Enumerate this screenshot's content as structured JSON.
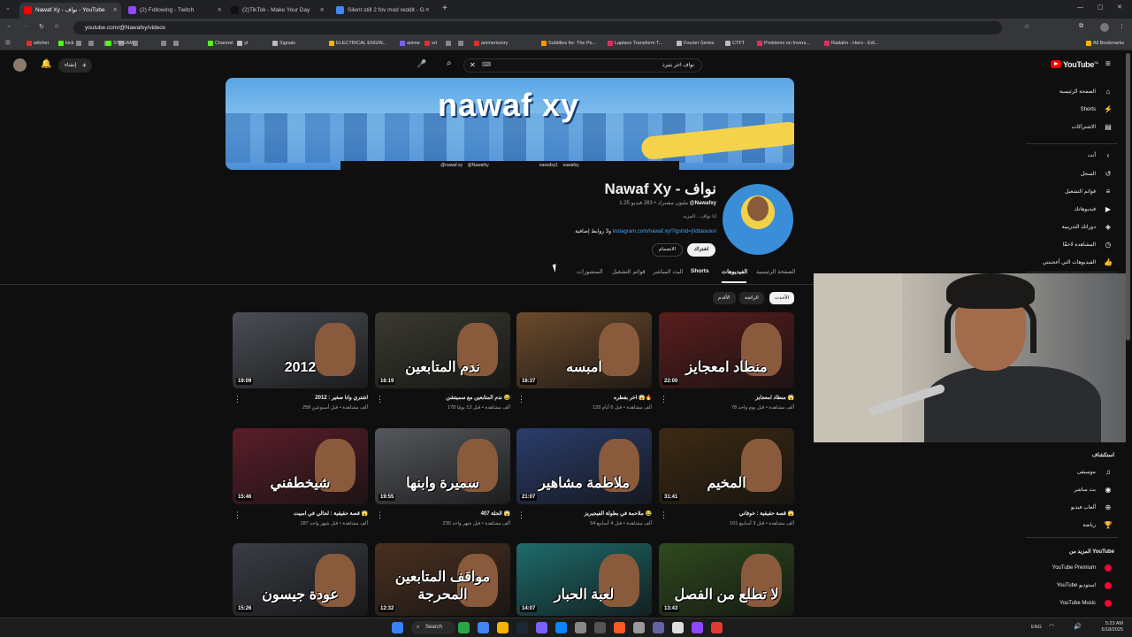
{
  "browser": {
    "tabs": [
      {
        "title": "Nawaf Xy - نواف - YouTube",
        "color": "#ff0000",
        "active": true
      },
      {
        "title": "(2) Following - Twitch",
        "color": "#9146ff",
        "active": false
      },
      {
        "title": "(2)TikTok - Make Your Day",
        "color": "#111111",
        "active": false
      },
      {
        "title": "Silent still 2 fov mod reddit - G",
        "color": "#4285f4",
        "active": false
      }
    ],
    "new_tab": "+",
    "url": "youtube.com/@Nawafxy/videos",
    "bookmarks": [
      {
        "label": "witcher",
        "color": "#e03030"
      },
      {
        "label": "kick",
        "color": "#53fc18"
      },
      {
        "label": "STREAM",
        "color": "#53fc18"
      },
      {
        "label": "Channel",
        "color": "#53fc18"
      },
      {
        "label": "yt",
        "color": "#bbbbbb"
      },
      {
        "label": "Signals",
        "color": "#bbbbbb"
      },
      {
        "label": "ELECTRICAL ENGIN...",
        "color": "#f4b400"
      },
      {
        "label": "anime",
        "color": "#7b61ff"
      },
      {
        "label": "srt",
        "color": "#e03030"
      },
      {
        "label": "animemunry",
        "color": "#e03030"
      },
      {
        "label": "Subtitles for: The Pe...",
        "color": "#ff9800"
      },
      {
        "label": "Laplace Transform T...",
        "color": "#e03060"
      },
      {
        "label": "Fourier Series",
        "color": "#bbbbbb"
      },
      {
        "label": "CTFT",
        "color": "#bbbbbb"
      },
      {
        "label": "Problems on Invers...",
        "color": "#e03060"
      },
      {
        "label": "Radahn - Hero - Edi...",
        "color": "#e03060"
      }
    ],
    "all_bookmarks": "All Bookmarks"
  },
  "youtube": {
    "logo": "YouTube",
    "region": "SA",
    "create_label": "إنشاء",
    "search_value": "نواف اخر بثيرذ",
    "sidebar": [
      {
        "label": "الصفحة الرئيسية",
        "icon": "home-icon",
        "glyph": "⌂"
      },
      {
        "label": "Shorts",
        "icon": "shorts-icon",
        "glyph": "⚡"
      },
      {
        "label": "الاشتراكات",
        "icon": "subscriptions-icon",
        "glyph": "▤"
      },
      {
        "label": "أنت",
        "icon": "chevron-left-icon",
        "glyph": "‹"
      },
      {
        "label": "السجل",
        "icon": "history-icon",
        "glyph": "↺"
      },
      {
        "label": "قوائم التشغيل",
        "icon": "playlist-icon",
        "glyph": "≡"
      },
      {
        "label": "فيديوهاتك",
        "icon": "your-videos-icon",
        "glyph": "▶"
      },
      {
        "label": "دوراتك التدريبية",
        "icon": "courses-icon",
        "glyph": "◈"
      },
      {
        "label": "المشاهدة لاحقًا",
        "icon": "watch-later-icon",
        "glyph": "◷"
      },
      {
        "label": "الفيديوهات التي أعجبتني",
        "icon": "like-icon",
        "glyph": "👍"
      }
    ],
    "explore_title": "استكشاف",
    "explore": [
      {
        "label": "موسيقى",
        "icon": "music-icon",
        "glyph": "♫"
      },
      {
        "label": "بث مباشر",
        "icon": "live-icon",
        "glyph": "◉"
      },
      {
        "label": "ألعاب فيديو",
        "icon": "gaming-icon",
        "glyph": "⊕"
      },
      {
        "label": "رياضة",
        "icon": "trophy-icon",
        "glyph": "🏆"
      }
    ],
    "more_title": "المزيد من YouTube",
    "more": [
      {
        "label": "YouTube Premium"
      },
      {
        "label": "YouTube استوديو"
      },
      {
        "label": "YouTube Music"
      }
    ]
  },
  "channel": {
    "banner_text": "nawaf xy",
    "banner_handles": [
      "@nawaf.xy",
      "@Nawafxy",
      "nawafxy1",
      "nawafxy"
    ],
    "name": "Nawaf Xy - نواف",
    "handle": "@Nawafxy",
    "stats": "1.25 مليون مشترك • 283 فيديو",
    "about": "انا نواف ...المزيد",
    "link": "instagram.com/nawaf.xy/?igshid=j0dtaouixvi",
    "link_more": "و3 روابط إضافية",
    "subscribe": "اشتراك",
    "join": "الانضمام",
    "tabs": [
      "الصفحة الرئيسية",
      "الفيديوهات",
      "Shorts",
      "البث المباشر",
      "قوائم التشغيل",
      "المنشورات"
    ],
    "active_tab": "الفيديوهات",
    "chips": [
      "الأحدث",
      "الرائجة",
      "الأقدم"
    ]
  },
  "videos": [
    {
      "title": "منطاد امعجايز 😱",
      "meta": "78 ألف مشاهدة • قبل يوم واحد",
      "duration": "22:00",
      "caption": "منطاد امعجايز",
      "bg": "#5a1d1d"
    },
    {
      "title": "اخر بفطره 😱🔥",
      "meta": "133 ألف مشاهدة • قبل 6 أيام",
      "duration": "16:37",
      "caption": "امبسه",
      "bg": "#6b4a2b"
    },
    {
      "title": "ندم المتابعين مع سميتشن 😂",
      "meta": "178 ألف مشاهدة • قبل 13 يومًا",
      "duration": "16:19",
      "caption": "ندم المتابعين",
      "bg": "#3a3a30"
    },
    {
      "title": "اشتري وانا صغير : 2012",
      "meta": "258 ألف مشاهدة • قبل أسبوعين",
      "duration": "19:09",
      "caption": "2012",
      "bg": "#4a4e55"
    },
    {
      "title": "قصة حقيقية : خوفاني 😱",
      "meta": "101 ألف مشاهدة • قبل 3 أسابيع",
      "duration": "31:41",
      "caption": "المخيم",
      "bg": "#3d2a12"
    },
    {
      "title": "ملاحمة في بطولة الفيجيريز 😂",
      "meta": "64 ألف مشاهدة • قبل 4 أسابيع",
      "duration": "21:07",
      "caption": "ملاطمة مشاهير",
      "bg": "#2b3d6b"
    },
    {
      "title": "الحلة 407 😱",
      "meta": "230 ألف مشاهدة • قبل شهر واحد",
      "duration": "19:55",
      "caption": "سميرة وابنها",
      "bg": "#55585d"
    },
    {
      "title": "قصة حقيقية : لحالي في امبيت 😱",
      "meta": "187 ألف مشاهدة • قبل شهر واحد",
      "duration": "15:46",
      "caption": "شيخطفني",
      "bg": "#5a1d2a"
    },
    {
      "title": "",
      "meta": "",
      "duration": "13:43",
      "caption": "لا تطلع من الفصل",
      "bg": "#2f4a1e"
    },
    {
      "title": "",
      "meta": "",
      "duration": "14:07",
      "caption": "لعبة الحبار",
      "bg": "#1e6b6b"
    },
    {
      "title": "",
      "meta": "",
      "duration": "12:32",
      "caption": "مواقف المتابعين المحرجة",
      "bg": "#4a3020"
    },
    {
      "title": "",
      "meta": "",
      "duration": "15:26",
      "caption": "عودة جيسون",
      "bg": "#3a3d45"
    }
  ],
  "taskbar": {
    "search": "Search",
    "lang": "ENG",
    "time": "5:23 AM",
    "date": "6/18/2025"
  }
}
